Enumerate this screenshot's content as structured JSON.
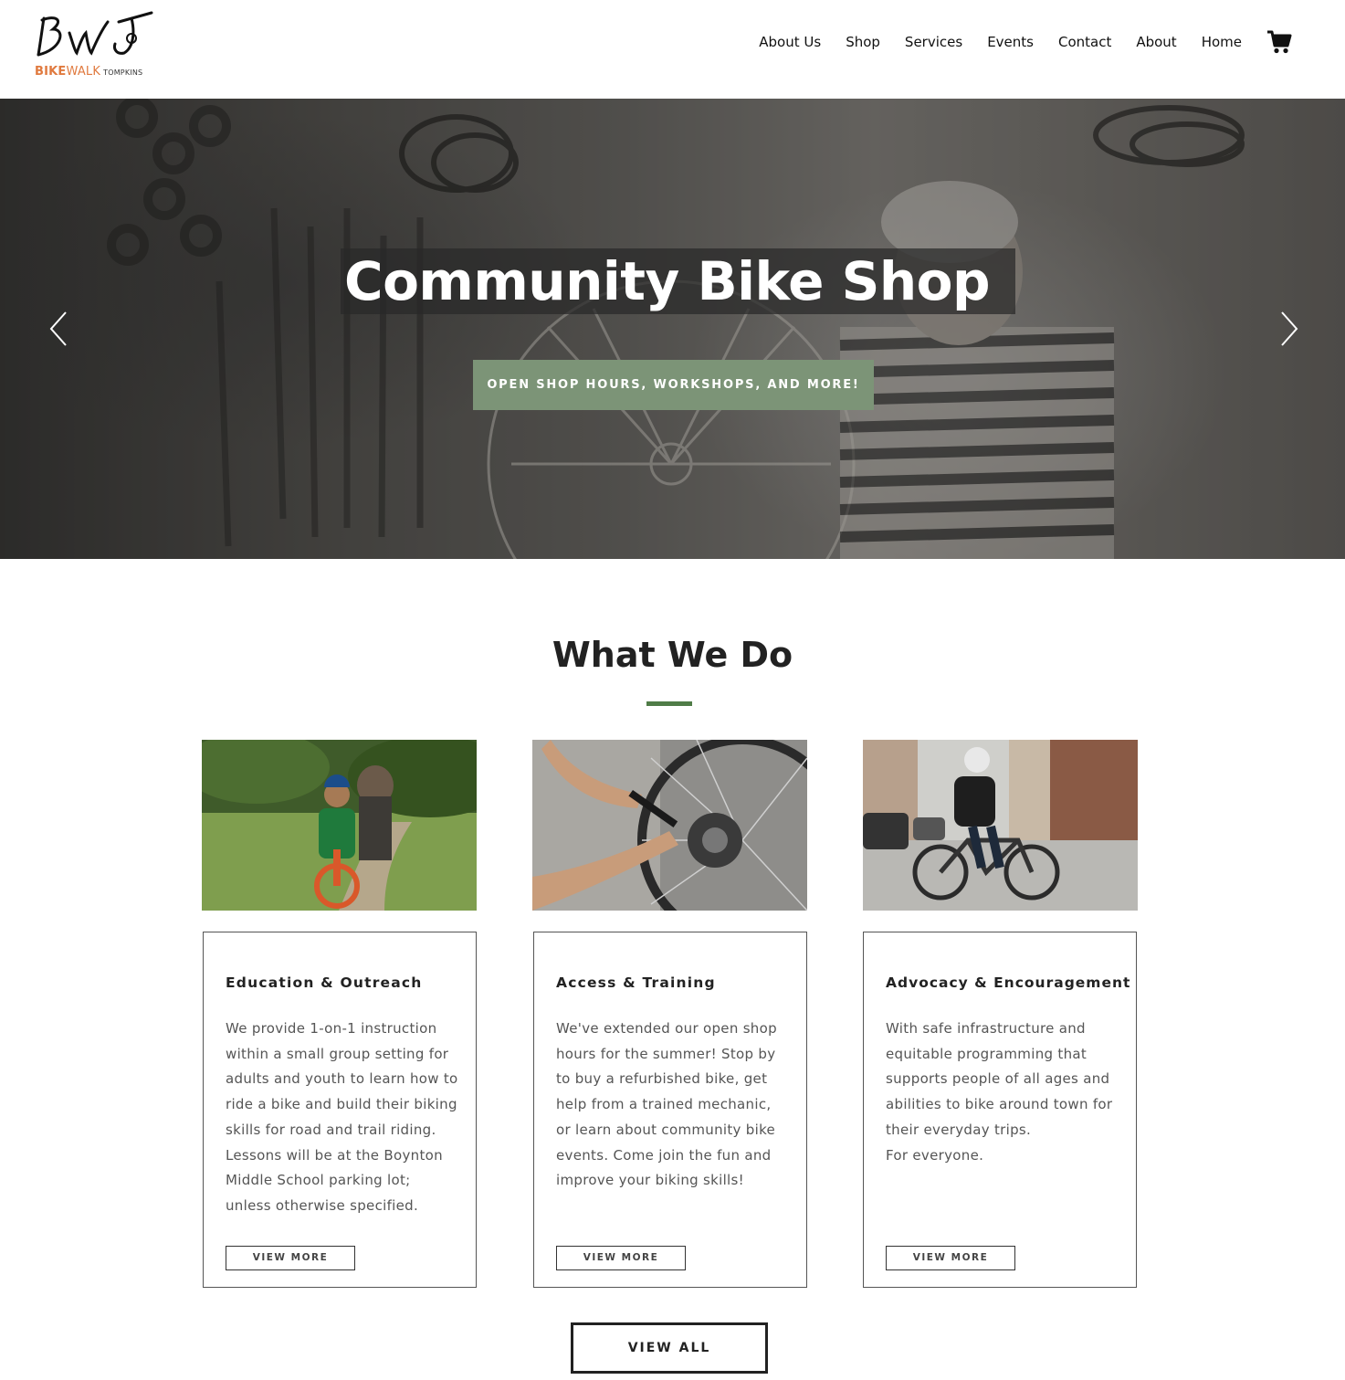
{
  "header": {
    "logo": {
      "mark": "BWT",
      "word1": "BIKE",
      "word2": "WALK",
      "word3": "TOMPKINS"
    },
    "nav": [
      "About Us",
      "Shop",
      "Services",
      "Events",
      "Contact",
      "About",
      "Home"
    ],
    "cart_icon": "shopping-cart-icon"
  },
  "hero": {
    "title": "Community Bike Shop",
    "button_label": "OPEN SHOP HOURS, WORKSHOPS, AND MORE!",
    "button_color": "#7c9477",
    "prev_icon": "chevron-left-icon",
    "next_icon": "chevron-right-icon"
  },
  "section": {
    "title": "What We Do",
    "accent_color": "#4f7c47"
  },
  "cards": [
    {
      "title": "Education & Outreach",
      "text": "We provide 1-on-1 instruction within a small group setting for adults and youth to learn how to ride a bike and build their biking skills for road and trail riding. Lessons will be at the Boynton Middle School parking lot; unless otherwise specified.",
      "button": "VIEW MORE"
    },
    {
      "title": "Access & Training",
      "text": "We've extended our open shop hours for the summer! Stop by to buy a refurbished bike, get help from a trained mechanic, or learn about community bike events. Come join the fun and improve your biking skills!",
      "button": "VIEW MORE"
    },
    {
      "title": "Advocacy & Encouragement",
      "text_lines": [
        "With safe infrastructure and equitable programming that supports people of all ages and abilities to bike around town for their everyday trips.",
        "For everyone."
      ],
      "button": "VIEW MORE"
    }
  ],
  "view_all": "VIEW ALL"
}
